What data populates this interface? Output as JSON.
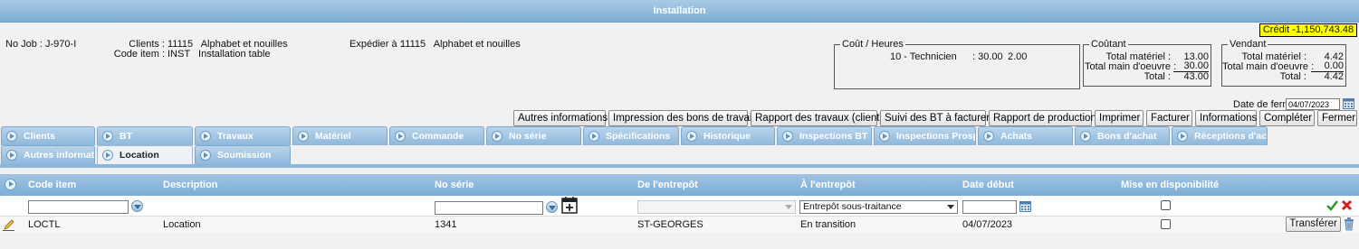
{
  "window": {
    "title": "Installation"
  },
  "credit": "Crédit -1,150,743.48",
  "job": {
    "no_job": "No Job : J-970-I",
    "clients_label": "Clients :",
    "clients_value": "11115   Alphabet et nouilles",
    "code_item_label": "Code item :",
    "code_item_value": "INST   Installation table",
    "expedier_label": "Expédier à :",
    "expedier_value": "11115   Alphabet et nouilles"
  },
  "cout_heures": {
    "legend": "Coût / Heures",
    "line_name": "10 - Technicien",
    "line_rate": ": 30.00",
    "line_hours": "2.00"
  },
  "coutant": {
    "legend": "Coûtant",
    "materiel_label": "Total matériel :",
    "materiel_value": "13.00",
    "main_label": "Total main d'oeuvre :",
    "main_value": "30.00",
    "total_label": "Total :",
    "total_value": "43.00"
  },
  "vendant": {
    "legend": "Vendant",
    "materiel_label": "Total matériel :",
    "materiel_value": "4.42",
    "main_label": "Total main d'oeuvre :",
    "main_value": "0.00",
    "total_label": "Total :",
    "total_value": "4.42"
  },
  "fermeture": {
    "label": "Date de fermeture :",
    "value": "04/07/2023"
  },
  "actions": [
    "Autres informations",
    "Impression des bons de travail",
    "Rapport des travaux (client)",
    "Suivi des BT à facturer",
    "Rapport de production",
    "Imprimer",
    "Facturer",
    "Informations",
    "Compléter",
    "Fermer"
  ],
  "tabs_row1": [
    "Clients",
    "BT",
    "Travaux",
    "Matériel",
    "Commande",
    "No série",
    "Spécifications",
    "Historique",
    "Inspections BT",
    "Inspections Prospect",
    "Achats",
    "Bons d'achat",
    "Réceptions d'achat"
  ],
  "tabs_row2": [
    "Autres informations",
    "Location",
    "Soumission"
  ],
  "active_tab": "Location",
  "grid": {
    "columns": [
      "Code item",
      "Description",
      "No série",
      "De l'entrepôt",
      "À l'entrepôt",
      "Date début",
      "Mise en disponibilité"
    ],
    "filter": {
      "code_item": "",
      "no_serie": "",
      "de_entrepot": "",
      "a_entrepot": "Entrepôt sous-traitance",
      "date_debut": ""
    },
    "rows": [
      {
        "code_item": "LOCTL",
        "description": "Location",
        "no_serie": "1341",
        "de_entrepot": "ST-GEORGES",
        "a_entrepot": "En transition",
        "date_debut": "04/07/2023",
        "action": "Transférer"
      }
    ]
  }
}
